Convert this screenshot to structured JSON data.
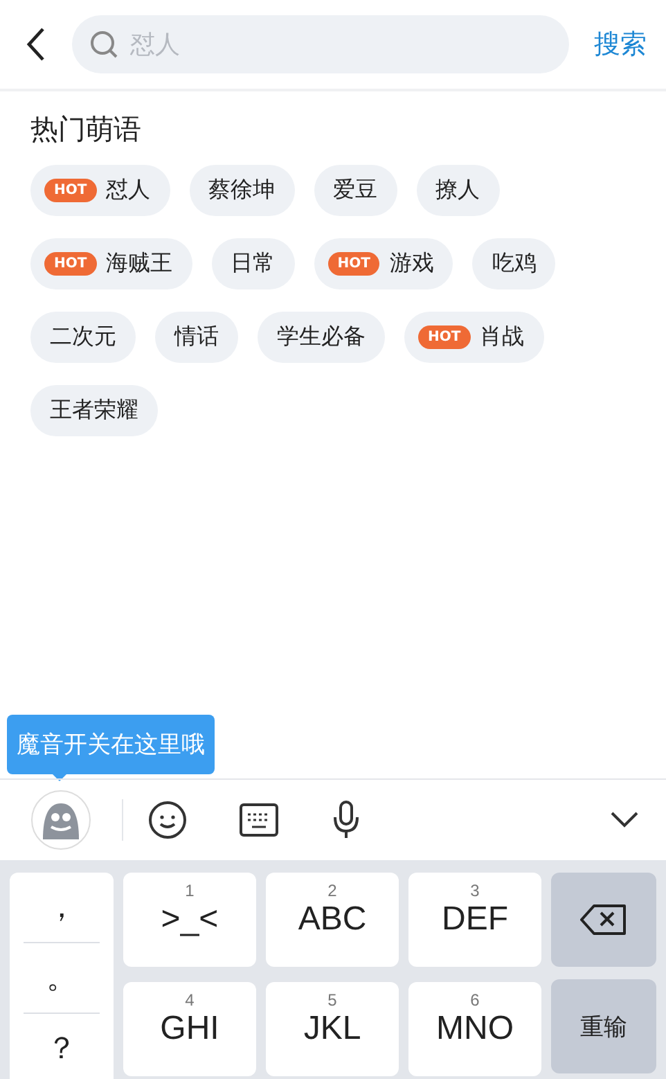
{
  "search": {
    "placeholder": "怼人",
    "button": "搜索"
  },
  "section_title": "热门萌语",
  "tags": [
    {
      "label": "怼人",
      "hot": true,
      "badge": "HOT"
    },
    {
      "label": "蔡徐坤",
      "hot": false
    },
    {
      "label": "爱豆",
      "hot": false
    },
    {
      "label": "撩人",
      "hot": false
    },
    {
      "label": "海贼王",
      "hot": true,
      "badge": "HOT"
    },
    {
      "label": "日常",
      "hot": false
    },
    {
      "label": "游戏",
      "hot": true,
      "badge": "HOT"
    },
    {
      "label": "吃鸡",
      "hot": false
    },
    {
      "label": "二次元",
      "hot": false
    },
    {
      "label": "情话",
      "hot": false
    },
    {
      "label": "学生必备",
      "hot": false
    },
    {
      "label": "肖战",
      "hot": true,
      "badge": "HOT"
    },
    {
      "label": "王者荣耀",
      "hot": false
    }
  ],
  "tooltip": "魔音开关在这里哦",
  "keyboard": {
    "punctuation": [
      "，",
      "。",
      "？"
    ],
    "keys": [
      {
        "number": "1",
        "letters": ">_<"
      },
      {
        "number": "2",
        "letters": "ABC"
      },
      {
        "number": "3",
        "letters": "DEF"
      },
      {
        "number": "4",
        "letters": "GHI"
      },
      {
        "number": "5",
        "letters": "JKL"
      },
      {
        "number": "6",
        "letters": "MNO"
      }
    ],
    "retype": "重输"
  }
}
